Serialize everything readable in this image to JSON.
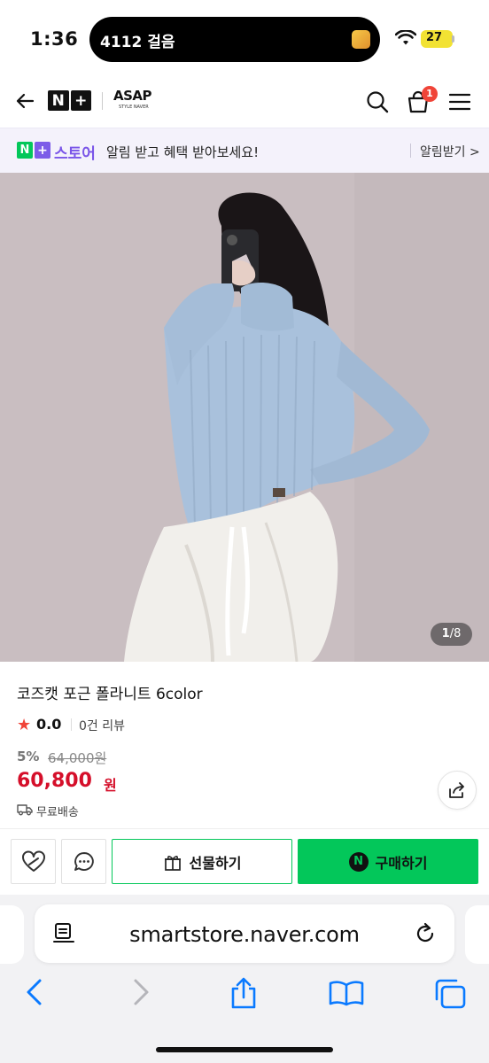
{
  "status_bar": {
    "time": "1:36",
    "live_activity": "4112 걸음",
    "battery": "27"
  },
  "header": {
    "logo_n": "N",
    "logo_plus": "+",
    "brand": "ASAP",
    "brand_sub": "STYLE NAVER",
    "cart_count": "1"
  },
  "notify_banner": {
    "store_name": "스토어",
    "message": "알림 받고 혜택 받아보세요!",
    "action": "알림받기 >"
  },
  "gallery": {
    "current": "1",
    "total": "/8"
  },
  "product": {
    "title": "코즈캣 포근 폴라니트 6color",
    "rating": "0.0",
    "reviews": "0건 리뷰",
    "discount": "5%",
    "original_price": "64,000원",
    "price": "60,800",
    "price_unit": "원",
    "shipping": "무료배송"
  },
  "actions": {
    "gift": "선물하기",
    "buy": "구매하기",
    "npay": "N"
  },
  "browser": {
    "url": "smartstore.naver.com"
  },
  "colors": {
    "naver_green": "#03c75a",
    "price_red": "#d50f2a",
    "store_purple": "#7a55e8",
    "ios_blue": "#0a7aff"
  }
}
